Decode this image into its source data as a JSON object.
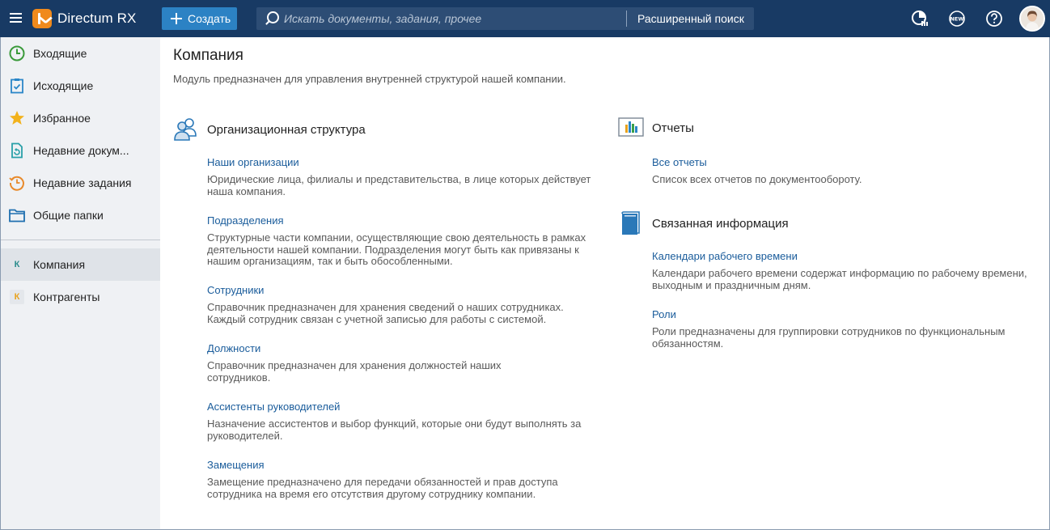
{
  "app": {
    "name": "Directum RX",
    "create_label": "Создать",
    "search_placeholder": "Искать документы, задания, прочее",
    "advanced_search_label": "Расширенный поиск",
    "top_icons": [
      "reports-icon",
      "new-features-icon",
      "help-icon",
      "user-avatar"
    ],
    "colors": {
      "topbar": "#183a64",
      "accent": "#2c82c4",
      "link": "#1a5c9b",
      "logo": "#f08a1c"
    }
  },
  "sidebar": {
    "items": [
      {
        "label": "Входящие",
        "icon": "clock-icon"
      },
      {
        "label": "Исходящие",
        "icon": "clipboard-check-icon"
      },
      {
        "label": "Избранное",
        "icon": "star-icon"
      },
      {
        "label": "Недавние докум...",
        "icon": "recent-document-icon"
      },
      {
        "label": "Недавние задания",
        "icon": "recent-tasks-icon"
      },
      {
        "label": "Общие папки",
        "icon": "folder-icon"
      }
    ],
    "modules": [
      {
        "label": "Компания",
        "badge": "К",
        "active": true
      },
      {
        "label": "Контрагенты",
        "badge": "К",
        "active": false
      }
    ]
  },
  "main": {
    "title": "Компания",
    "description": "Модуль предназначен для управления внутренней структурой нашей компании.",
    "sections": {
      "org": {
        "title": "Организационная структура",
        "items": [
          {
            "link": "Наши организации",
            "desc": "Юридические лица, филиалы и представительства, в лице которых действует наша компания."
          },
          {
            "link": "Подразделения",
            "desc": "Структурные части компании, осуществляющие свою деятельность в рамках деятельности нашей компании. Подразделения могут быть как привязаны к нашим организациям, так и быть обособленными."
          },
          {
            "link": "Сотрудники",
            "desc": "Справочник предназначен для хранения сведений о наших сотрудниках. Каждый сотрудник связан с учетной записью для работы с системой."
          },
          {
            "link": "Должности",
            "desc": "Справочник предназначен для хранения должностей наших сотрудников."
          },
          {
            "link": "Ассистенты руководителей",
            "desc": "Назначение ассистентов и выбор функций, которые они будут выполнять за руководителей."
          },
          {
            "link": "Замещения",
            "desc": "Замещение предназначено для передачи обязанностей и прав доступа сотрудника на время его отсутствия другому сотруднику компании."
          }
        ]
      },
      "reports": {
        "title": "Отчеты",
        "items": [
          {
            "link": "Все отчеты",
            "desc": "Список всех отчетов по документообороту."
          }
        ]
      },
      "related": {
        "title": "Связанная информация",
        "items": [
          {
            "link": "Календари рабочего времени",
            "desc": "Календари рабочего времени содержат информацию по рабочему времени, выходным и праздничным дням."
          },
          {
            "link": "Роли",
            "desc": "Роли предназначены для группировки сотрудников по функциональным обязанностям."
          }
        ]
      }
    }
  }
}
